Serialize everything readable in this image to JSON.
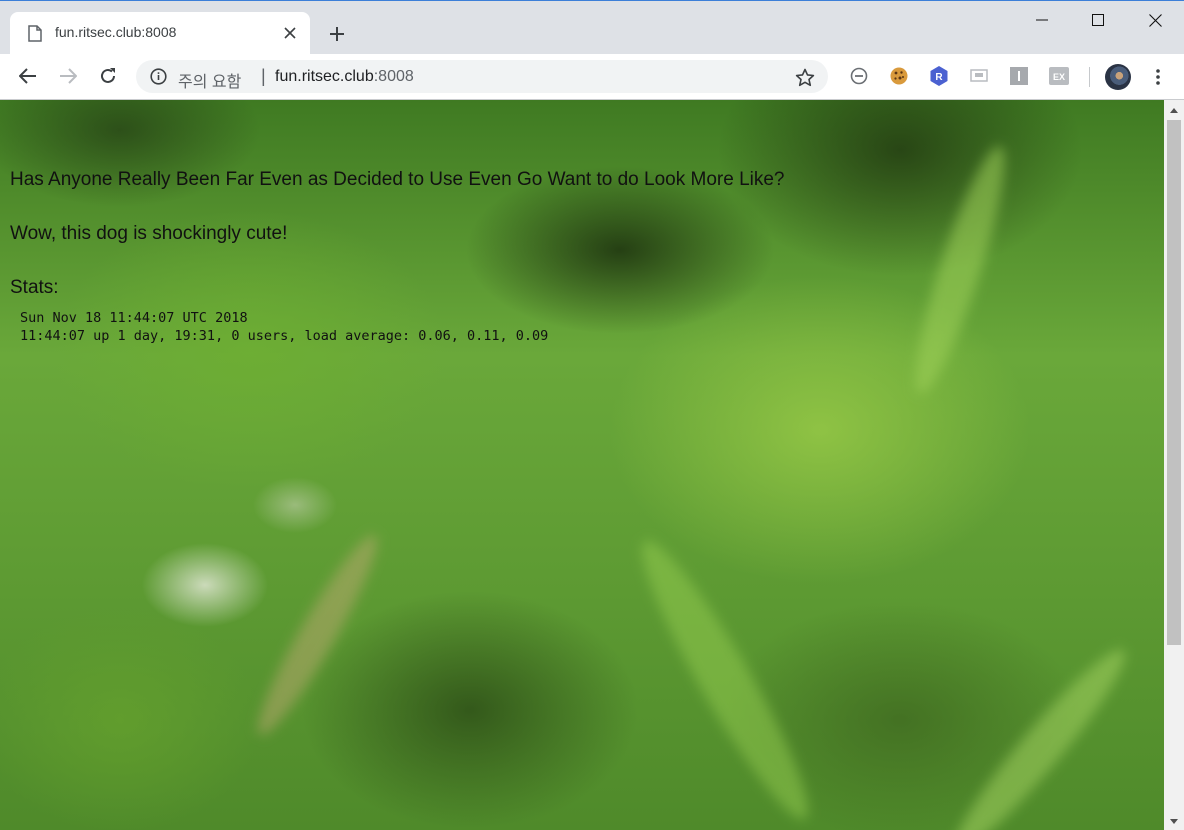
{
  "browser": {
    "tab": {
      "title": "fun.ritsec.club:8008"
    },
    "omnibox": {
      "security_label": "주의 요함",
      "separator": "|",
      "url_host": "fun.ritsec.club",
      "url_port": ":8008"
    },
    "extensions": [
      "minus-circle-icon",
      "cookie-icon",
      "r-badge-icon",
      "screen-icon",
      "bookmark-i-icon",
      "ex-icon"
    ]
  },
  "page": {
    "headline": "Has Anyone Really Been Far Even as Decided to Use Even Go Want to do Look More Like?",
    "subtitle": "Wow, this dog is shockingly cute!",
    "stats_label": "Stats:",
    "stats_lines": [
      "Sun Nov 18 11:44:07 UTC 2018",
      "11:44:07 up 1 day, 19:31, 0 users, load average: 0.06, 0.11, 0.09"
    ]
  }
}
